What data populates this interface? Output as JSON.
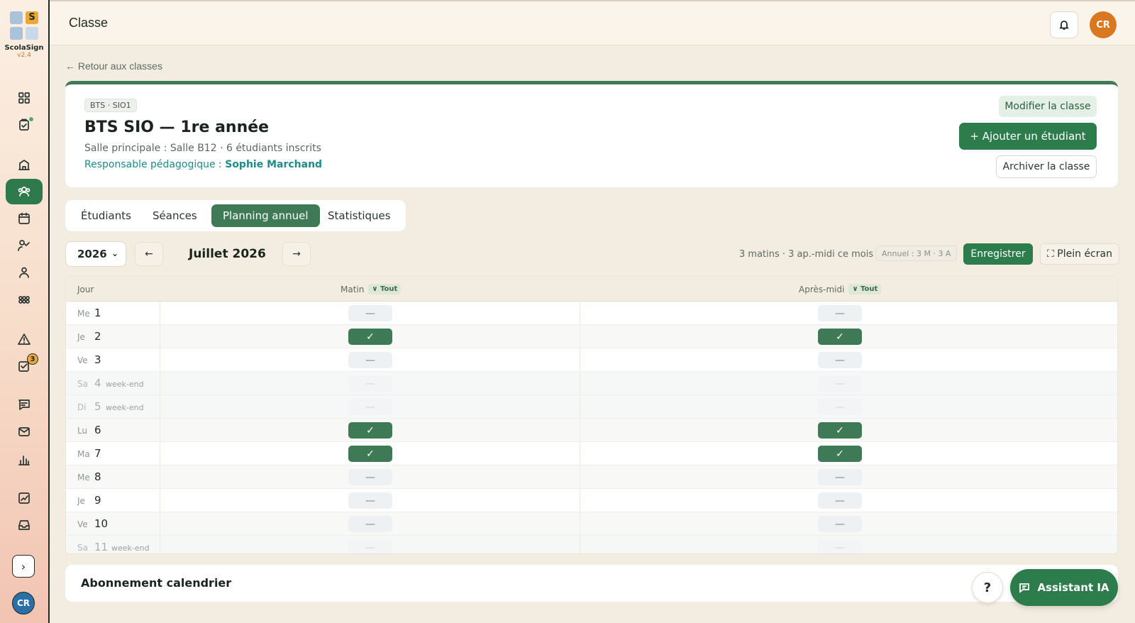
{
  "sidebar": {
    "logo_letter": "S",
    "brand": "ScolaSign",
    "version": "v2.4",
    "icons": [
      "dashboard-icon",
      "clipboard-icon",
      "building-icon",
      "users-icon",
      "calendar-icon",
      "check-person-icon",
      "person-icon",
      "groups-icon",
      "alert-icon",
      "tasks-icon",
      "chat-icon",
      "mail-icon",
      "bar-chart-icon",
      "trend-chart-icon",
      "inbox-icon"
    ],
    "tasks_badge": "3",
    "expand": "›",
    "avatar": "CR"
  },
  "header": {
    "title": "Classe",
    "avatar": "CR"
  },
  "back_link": "← Retour aux classes",
  "class": {
    "tag": "BTS · SIO1",
    "name": "BTS SIO — 1re année",
    "subtitle": "Salle principale : Salle B12 · 6 étudiants inscrits",
    "resp_label": "Responsable pédagogique : ",
    "resp_name": "Sophie Marchand",
    "modify_label": "Modifier la classe",
    "add_label": "+ Ajouter un étudiant",
    "archive_label": "Archiver la classe"
  },
  "tabs": [
    {
      "label": "Étudiants",
      "active": false
    },
    {
      "label": "Séances",
      "active": false
    },
    {
      "label": "Planning annuel",
      "active": true
    },
    {
      "label": "Statistiques",
      "active": false
    }
  ],
  "controls": {
    "year": "2026",
    "prev": "←",
    "next": "→",
    "month": "Juillet 2026",
    "summary": "3 matins · 3 ap.-midi ce mois",
    "annual": "Annuel : 3 M · 3 A",
    "save_label": "Enregistrer",
    "fullscreen_label": "⛶ Plein écran"
  },
  "table": {
    "col_day": "Jour",
    "col_morning": "Matin",
    "col_afternoon": "Après-midi",
    "all_chip": "∨ Tout",
    "weekend_label": "week-end",
    "rows": [
      {
        "dow": "Me",
        "day": "1",
        "weekend": false,
        "morning": false,
        "afternoon": false
      },
      {
        "dow": "Je",
        "day": "2",
        "weekend": false,
        "morning": true,
        "afternoon": true
      },
      {
        "dow": "Ve",
        "day": "3",
        "weekend": false,
        "morning": false,
        "afternoon": false
      },
      {
        "dow": "Sa",
        "day": "4",
        "weekend": true,
        "morning": false,
        "afternoon": false
      },
      {
        "dow": "Di",
        "day": "5",
        "weekend": true,
        "morning": false,
        "afternoon": false
      },
      {
        "dow": "Lu",
        "day": "6",
        "weekend": false,
        "morning": true,
        "afternoon": true
      },
      {
        "dow": "Ma",
        "day": "7",
        "weekend": false,
        "morning": true,
        "afternoon": true
      },
      {
        "dow": "Me",
        "day": "8",
        "weekend": false,
        "morning": false,
        "afternoon": false
      },
      {
        "dow": "Je",
        "day": "9",
        "weekend": false,
        "morning": false,
        "afternoon": false
      },
      {
        "dow": "Ve",
        "day": "10",
        "weekend": false,
        "morning": false,
        "afternoon": false
      },
      {
        "dow": "Sa",
        "day": "11",
        "weekend": true,
        "morning": false,
        "afternoon": false
      }
    ],
    "on_symbol": "✓",
    "off_symbol": "—"
  },
  "subscription": {
    "title": "Abonnement calendrier"
  },
  "help_label": "?",
  "assistant_label": "Assistant IA",
  "colors": {
    "primary": "#2d7d4c",
    "accent": "#d9781f",
    "teal": "#1f8a8a"
  }
}
